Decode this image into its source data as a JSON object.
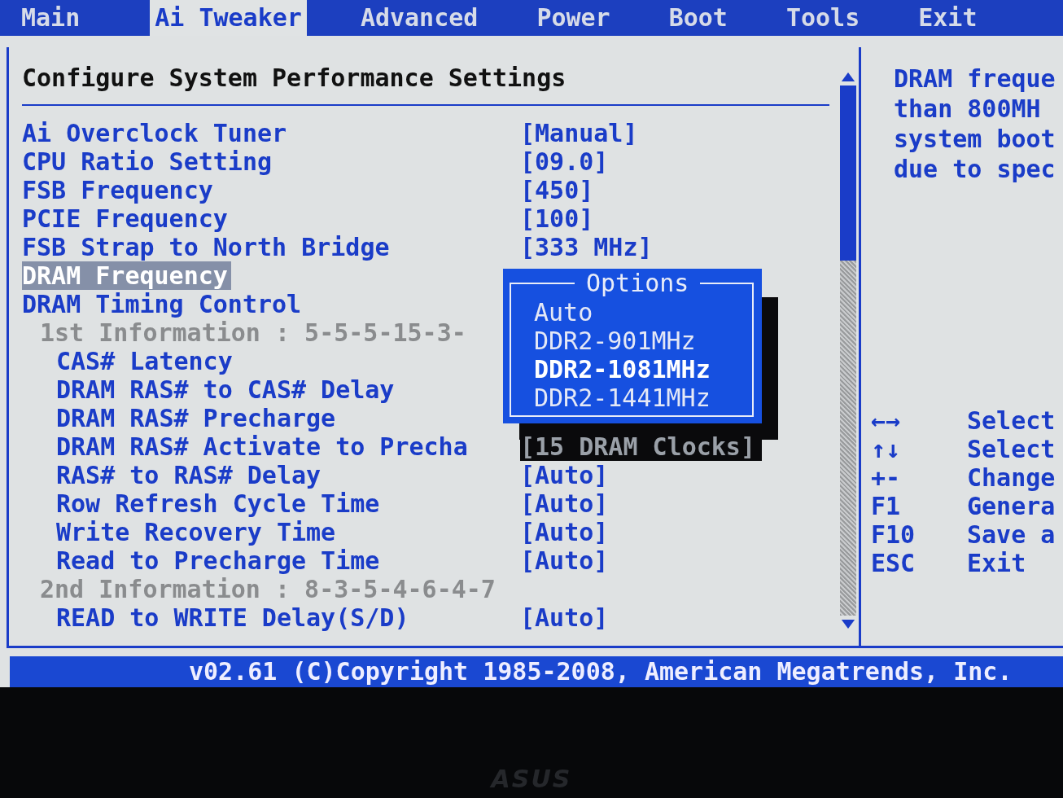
{
  "tabs": [
    {
      "label": "Main",
      "selected": false
    },
    {
      "label": "Ai Tweaker",
      "selected": true
    },
    {
      "label": "Advanced",
      "selected": false
    },
    {
      "label": "Power",
      "selected": false
    },
    {
      "label": "Boot",
      "selected": false
    },
    {
      "label": "Tools",
      "selected": false
    },
    {
      "label": "Exit",
      "selected": false
    }
  ],
  "panel_title": "Configure System Performance Settings",
  "settings": [
    {
      "kind": "setting",
      "label": "Ai Overclock Tuner",
      "value": "[Manual]",
      "selected": false
    },
    {
      "kind": "setting",
      "label": "CPU Ratio Setting",
      "value": "[09.0]",
      "selected": false
    },
    {
      "kind": "setting",
      "label": "FSB Frequency",
      "value": "[450]",
      "selected": false
    },
    {
      "kind": "setting",
      "label": "PCIE Frequency",
      "value": "[100]",
      "selected": false
    },
    {
      "kind": "setting",
      "label": "FSB Strap to North Bridge",
      "value": "[333 MHz]",
      "selected": false
    },
    {
      "kind": "setting",
      "label": "DRAM Frequency",
      "selected": true
    },
    {
      "kind": "submenu",
      "label": "DRAM Timing Control",
      "selected": false,
      "children": [
        {
          "kind": "info",
          "label": "1st Information : 5-5-5-15-3-"
        },
        {
          "kind": "setting",
          "label": "CAS# Latency",
          "selected": false
        },
        {
          "kind": "setting",
          "label": "DRAM RAS# to CAS# Delay",
          "selected": false
        },
        {
          "kind": "setting",
          "label": "DRAM RAS# Precharge",
          "selected": false
        },
        {
          "kind": "setting",
          "label": "DRAM RAS# Activate to Precha",
          "value": "[15 DRAM Clocks]",
          "shaded": true,
          "selected": false
        },
        {
          "kind": "setting",
          "label": "RAS# to RAS# Delay",
          "value": "[Auto]",
          "selected": false
        },
        {
          "kind": "setting",
          "label": "Row Refresh Cycle Time",
          "value": "[Auto]",
          "selected": false
        },
        {
          "kind": "setting",
          "label": "Write Recovery Time",
          "value": "[Auto]",
          "selected": false
        },
        {
          "kind": "setting",
          "label": "Read to Precharge Time",
          "value": "[Auto]",
          "selected": false
        },
        {
          "kind": "info",
          "label": "2nd Information : 8-3-5-4-6-4-7"
        },
        {
          "kind": "setting",
          "label": "READ to WRITE Delay(S/D)",
          "value": "[Auto]",
          "selected": false
        }
      ]
    }
  ],
  "options_popup": {
    "title": "Options",
    "options": [
      {
        "label": "Auto",
        "selected": false
      },
      {
        "label": "DDR2-901MHz",
        "selected": false
      },
      {
        "label": "DDR2-1081MHz",
        "selected": true
      },
      {
        "label": "DDR2-1441MHz",
        "selected": false
      }
    ]
  },
  "help_text": [
    "DRAM freque",
    "than 800MH",
    "system boot",
    "due to spec"
  ],
  "key_legend": [
    {
      "key": "←→",
      "action": "Select"
    },
    {
      "key": "↑↓",
      "action": "Select"
    },
    {
      "key": "+-",
      "action": "Change"
    },
    {
      "key": "F1",
      "action": "Genera"
    },
    {
      "key": "F10",
      "action": "Save a"
    },
    {
      "key": "ESC",
      "action": "Exit"
    }
  ],
  "status_bar": "v02.61 (C)Copyright 1985-2008, American Megatrends, Inc.",
  "bezel_logo": "ASUS"
}
